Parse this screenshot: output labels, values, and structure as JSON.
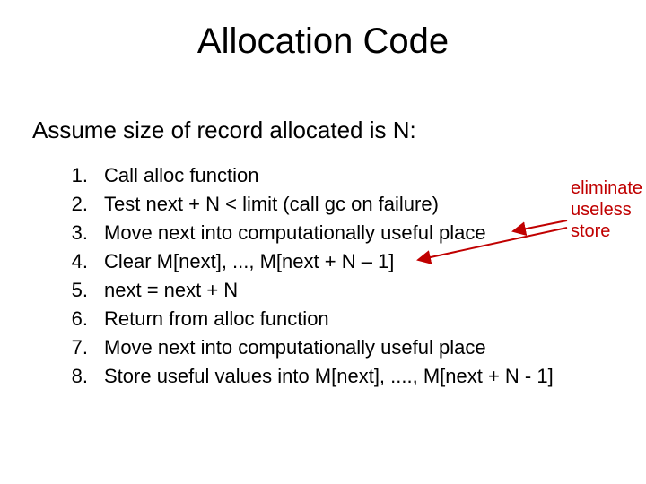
{
  "title": "Allocation Code",
  "subhead": "Assume size of record allocated is N:",
  "items": [
    {
      "n": "1.",
      "text": "Call alloc function"
    },
    {
      "n": "2.",
      "text": "Test next + N < limit   (call gc on failure)"
    },
    {
      "n": "3.",
      "text": "Move next into computationally useful place"
    },
    {
      "n": "4.",
      "text": "Clear M[next], ..., M[next + N – 1]"
    },
    {
      "n": "5.",
      "text": "next = next + N"
    },
    {
      "n": "6.",
      "text": "Return from alloc function"
    },
    {
      "n": "7.",
      "text": "Move next into computationally useful place"
    },
    {
      "n": "8.",
      "text": "Store useful values into M[next], ...., M[next + N - 1]"
    }
  ],
  "annotation": {
    "line1": "eliminate",
    "line2": "useless",
    "line3": "store"
  }
}
